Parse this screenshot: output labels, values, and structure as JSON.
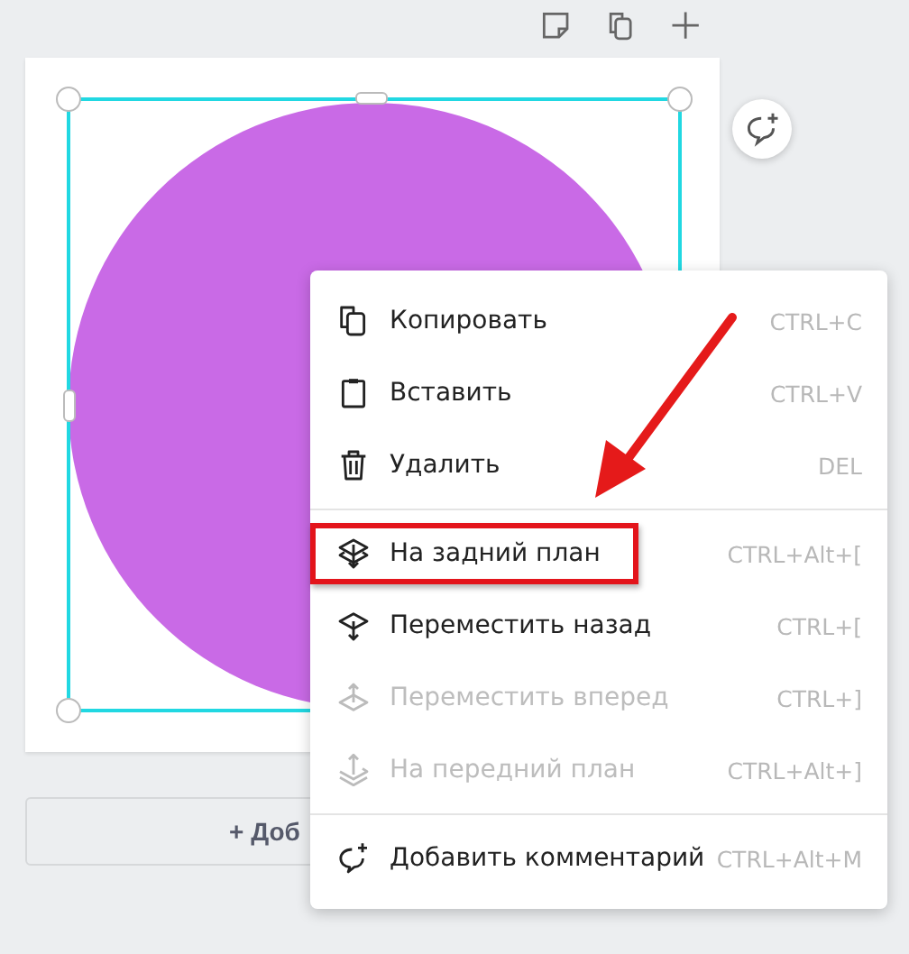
{
  "add_page_button": {
    "label": "+ Доб"
  },
  "context_menu": {
    "groups": [
      [
        {
          "label": "Копировать",
          "shortcut": "CTRL+C",
          "disabled": false,
          "highlighted": false
        },
        {
          "label": "Вставить",
          "shortcut": "CTRL+V",
          "disabled": false,
          "highlighted": false
        },
        {
          "label": "Удалить",
          "shortcut": "DEL",
          "disabled": false,
          "highlighted": false
        }
      ],
      [
        {
          "label": "На задний план",
          "shortcut": "CTRL+Alt+[",
          "disabled": false,
          "highlighted": true
        },
        {
          "label": "Переместить назад",
          "shortcut": "CTRL+[",
          "disabled": false,
          "highlighted": false
        },
        {
          "label": "Переместить вперед",
          "shortcut": "CTRL+]",
          "disabled": true,
          "highlighted": false
        },
        {
          "label": "На передний план",
          "shortcut": "CTRL+Alt+]",
          "disabled": true,
          "highlighted": false
        }
      ],
      [
        {
          "label": "Добавить комментарий",
          "shortcut": "CTRL+Alt+M",
          "disabled": false,
          "highlighted": false
        }
      ]
    ]
  }
}
